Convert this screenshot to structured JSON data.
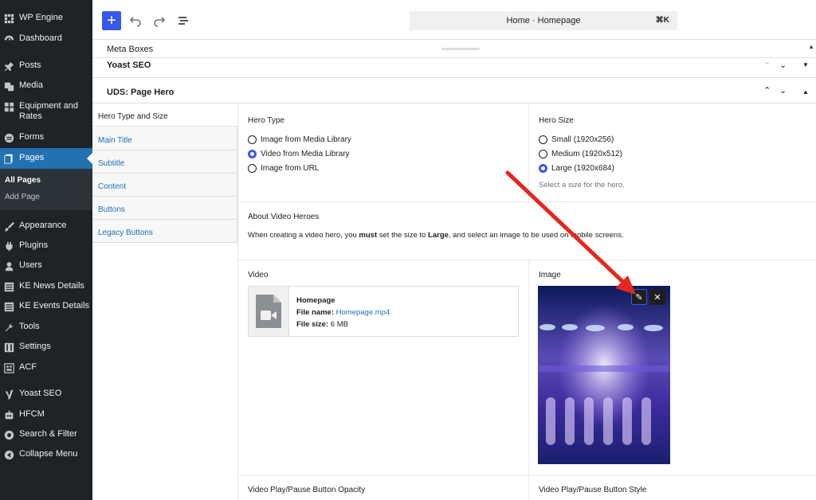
{
  "sidebar": {
    "items": [
      {
        "label": "WP Engine",
        "icon": "wp-engine-icon"
      },
      {
        "label": "Dashboard",
        "icon": "dashboard-icon"
      },
      {
        "label": "Posts",
        "icon": "pin-icon"
      },
      {
        "label": "Media",
        "icon": "media-icon"
      },
      {
        "label": "Equipment and Rates",
        "icon": "grid-icon"
      },
      {
        "label": "Forms",
        "icon": "forms-icon"
      },
      {
        "label": "Pages",
        "icon": "pages-icon"
      },
      {
        "label": "Appearance",
        "icon": "brush-icon"
      },
      {
        "label": "Plugins",
        "icon": "plugin-icon"
      },
      {
        "label": "Users",
        "icon": "users-icon"
      },
      {
        "label": "KE News Details",
        "icon": "list-icon"
      },
      {
        "label": "KE Events Details",
        "icon": "list-icon"
      },
      {
        "label": "Tools",
        "icon": "wrench-icon"
      },
      {
        "label": "Settings",
        "icon": "settings-icon"
      },
      {
        "label": "ACF",
        "icon": "acf-icon"
      },
      {
        "label": "Yoast SEO",
        "icon": "yoast-icon"
      },
      {
        "label": "HFCM",
        "icon": "robot-icon"
      },
      {
        "label": "Search & Filter",
        "icon": "search-filter-icon"
      },
      {
        "label": "Collapse Menu",
        "icon": "collapse-icon"
      }
    ],
    "sub_items": {
      "all_pages": "All Pages",
      "add_page": "Add Page"
    }
  },
  "topbar": {
    "plus": "+",
    "command_title": "Home · Homepage",
    "shortcut": "⌘K"
  },
  "meta": {
    "title": "Meta Boxes"
  },
  "yoast": {
    "title": "Yoast SEO"
  },
  "hero": {
    "title": "UDS: Page Hero",
    "tabs": [
      "Hero Type and Size",
      "Main Title",
      "Subtitle",
      "Content",
      "Buttons",
      "Legacy Buttons"
    ],
    "hero_type": {
      "label": "Hero Type",
      "options": [
        "Image from Media Library",
        "Video from Media Library",
        "Image from URL"
      ],
      "selected": "Video from Media Library"
    },
    "hero_size": {
      "label": "Hero Size",
      "options": [
        "Small (1920x256)",
        "Medium (1920x512)",
        "Large (1920x684)"
      ],
      "selected": "Large (1920x684)",
      "hint": "Select a size for the hero."
    },
    "about": {
      "label": "About Video Heroes",
      "t1": "When creating a video hero, you ",
      "b1": "must",
      "t2": " set the size to ",
      "b2": "Large",
      "t3": ", and select an image to be used on mobile screens."
    },
    "video": {
      "label": "Video",
      "name": "Homepage",
      "file_label": "File name:",
      "file_name": "Homepage.mp4",
      "size_label": "File size:",
      "file_size": "6 MB"
    },
    "image": {
      "label": "Image",
      "edit_glyph": "✎",
      "close_glyph": "✕"
    },
    "opacity_label": "Video Play/Pause Button Opacity",
    "style_label": "Video Play/Pause Button Style"
  },
  "colors": {
    "accent": "#3858e9",
    "sidebar": "#1d2327",
    "active": "#2271b1",
    "arrow": "#e5261f"
  }
}
